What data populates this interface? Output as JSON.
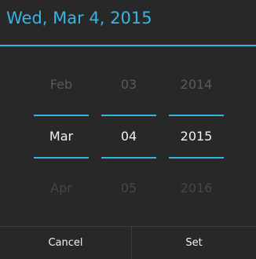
{
  "header": {
    "title": "Wed, Mar 4, 2015",
    "accent_color": "#33b5e5"
  },
  "picker": {
    "month": {
      "prev": "Feb",
      "current": "Mar",
      "next": "Apr"
    },
    "day": {
      "prev": "03",
      "current": "04",
      "next": "05"
    },
    "year": {
      "prev": "2014",
      "current": "2015",
      "next": "2016"
    }
  },
  "buttons": {
    "cancel_label": "Cancel",
    "set_label": "Set"
  }
}
